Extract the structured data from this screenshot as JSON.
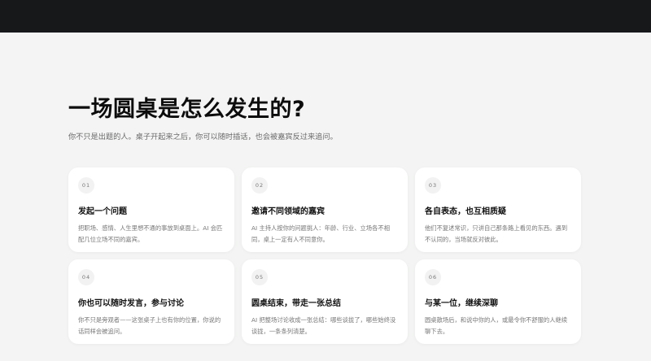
{
  "header": {
    "title": "一场圆桌是怎么发生的?",
    "subtitle": "你不只是出题的人。桌子开起来之后，你可以随时插话，也会被嘉宾反过来追问。"
  },
  "steps": [
    {
      "num": "01",
      "title": "发起一个问题",
      "desc": "把职场、感情、人生里想不通的事放到桌面上。AI 会匹配几位立场不同的嘉宾。"
    },
    {
      "num": "02",
      "title": "邀请不同领域的嘉宾",
      "desc": "AI 主持人按你的问题挑人：年龄、行业、立场各不相同，桌上一定有人不同意你。"
    },
    {
      "num": "03",
      "title": "各自表态，也互相质疑",
      "desc": "他们不复述常识，只讲自己那条路上看见的东西。遇到不认同的，当场就反对彼此。"
    },
    {
      "num": "04",
      "title": "你也可以随时发言，参与讨论",
      "desc": "你不只是旁观者——这张桌子上也有你的位置，你说的话同样会被追问。"
    },
    {
      "num": "05",
      "title": "圆桌结束，带走一张总结",
      "desc": "AI 把整场讨论收成一张总结：哪些谈拢了，哪些始终没谈拢，一条条列清楚。"
    },
    {
      "num": "06",
      "title": "与某一位，继续深聊",
      "desc": "圆桌散场后，和说中你的人，或最令你不舒服的人继续聊下去。"
    }
  ]
}
